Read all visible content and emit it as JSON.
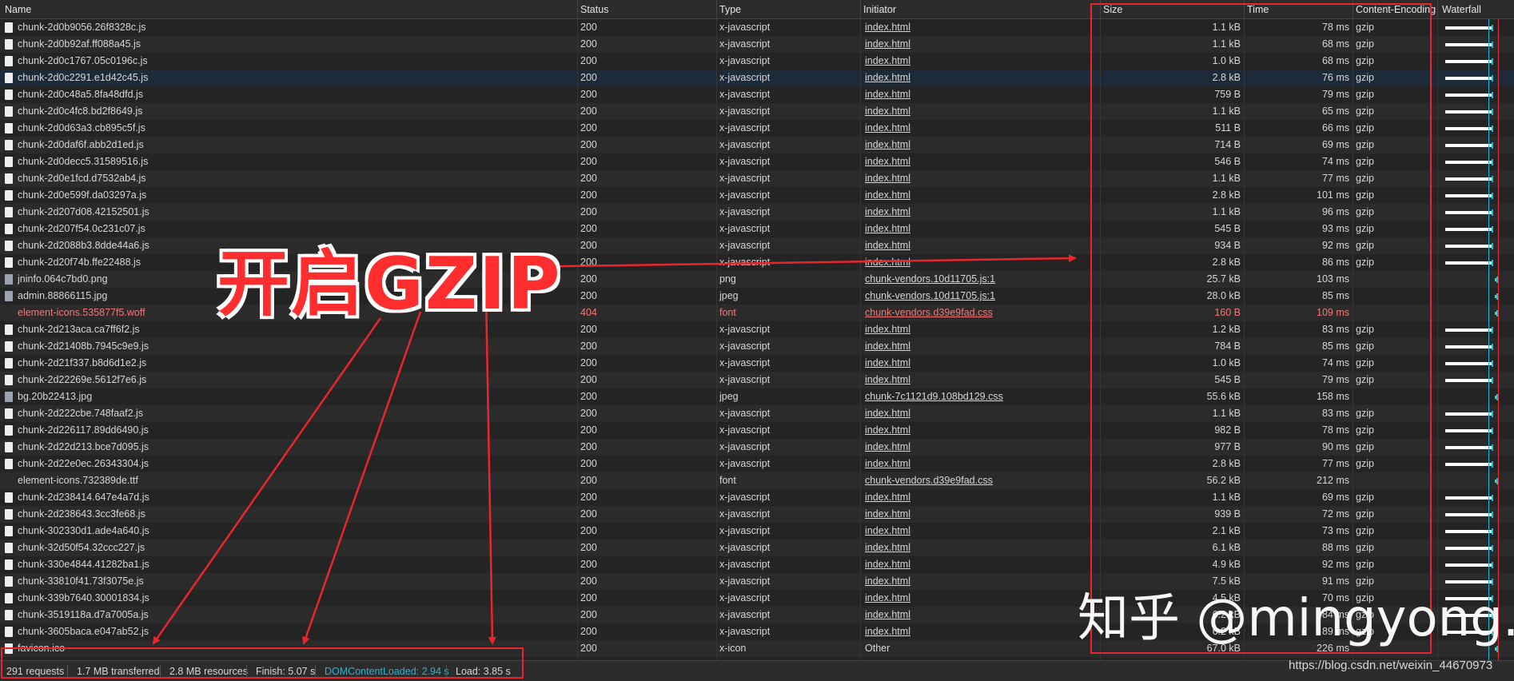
{
  "columns": {
    "name": "Name",
    "status": "Status",
    "type": "Type",
    "initiator": "Initiator",
    "size": "Size",
    "time": "Time",
    "encoding": "Content-Encoding",
    "waterfall": "Waterfall"
  },
  "rows": [
    {
      "name": "chunk-2d0b9056.26f8328c.js",
      "status": "200",
      "type": "x-javascript",
      "initiator": "index.html",
      "size": "1.1 kB",
      "time": "78 ms",
      "encoding": "gzip",
      "icon": "file-icon"
    },
    {
      "name": "chunk-2d0b92af.ff088a45.js",
      "status": "200",
      "type": "x-javascript",
      "initiator": "index.html",
      "size": "1.1 kB",
      "time": "68 ms",
      "encoding": "gzip",
      "icon": "file-icon"
    },
    {
      "name": "chunk-2d0c1767.05c0196c.js",
      "status": "200",
      "type": "x-javascript",
      "initiator": "index.html",
      "size": "1.0 kB",
      "time": "68 ms",
      "encoding": "gzip",
      "icon": "file-icon"
    },
    {
      "name": "chunk-2d0c2291.e1d42c45.js",
      "status": "200",
      "type": "x-javascript",
      "initiator": "index.html",
      "size": "2.8 kB",
      "time": "76 ms",
      "encoding": "gzip",
      "icon": "file-icon"
    },
    {
      "name": "chunk-2d0c48a5.8fa48dfd.js",
      "status": "200",
      "type": "x-javascript",
      "initiator": "index.html",
      "size": "759 B",
      "time": "79 ms",
      "encoding": "gzip",
      "icon": "file-icon"
    },
    {
      "name": "chunk-2d0c4fc8.bd2f8649.js",
      "status": "200",
      "type": "x-javascript",
      "initiator": "index.html",
      "size": "1.1 kB",
      "time": "65 ms",
      "encoding": "gzip",
      "icon": "file-icon"
    },
    {
      "name": "chunk-2d0d63a3.cb895c5f.js",
      "status": "200",
      "type": "x-javascript",
      "initiator": "index.html",
      "size": "511 B",
      "time": "66 ms",
      "encoding": "gzip",
      "icon": "file-icon"
    },
    {
      "name": "chunk-2d0daf6f.abb2d1ed.js",
      "status": "200",
      "type": "x-javascript",
      "initiator": "index.html",
      "size": "714 B",
      "time": "69 ms",
      "encoding": "gzip",
      "icon": "file-icon"
    },
    {
      "name": "chunk-2d0decc5.31589516.js",
      "status": "200",
      "type": "x-javascript",
      "initiator": "index.html",
      "size": "546 B",
      "time": "74 ms",
      "encoding": "gzip",
      "icon": "file-icon"
    },
    {
      "name": "chunk-2d0e1fcd.d7532ab4.js",
      "status": "200",
      "type": "x-javascript",
      "initiator": "index.html",
      "size": "1.1 kB",
      "time": "77 ms",
      "encoding": "gzip",
      "icon": "file-icon"
    },
    {
      "name": "chunk-2d0e599f.da03297a.js",
      "status": "200",
      "type": "x-javascript",
      "initiator": "index.html",
      "size": "2.8 kB",
      "time": "101 ms",
      "encoding": "gzip",
      "icon": "file-icon"
    },
    {
      "name": "chunk-2d207d08.42152501.js",
      "status": "200",
      "type": "x-javascript",
      "initiator": "index.html",
      "size": "1.1 kB",
      "time": "96 ms",
      "encoding": "gzip",
      "icon": "file-icon"
    },
    {
      "name": "chunk-2d207f54.0c231c07.js",
      "status": "200",
      "type": "x-javascript",
      "initiator": "index.html",
      "size": "545 B",
      "time": "93 ms",
      "encoding": "gzip",
      "icon": "file-icon"
    },
    {
      "name": "chunk-2d2088b3.8dde44a6.js",
      "status": "200",
      "type": "x-javascript",
      "initiator": "index.html",
      "size": "934 B",
      "time": "92 ms",
      "encoding": "gzip",
      "icon": "file-icon"
    },
    {
      "name": "chunk-2d20f74b.ffe22488.js",
      "status": "200",
      "type": "x-javascript",
      "initiator": "index.html",
      "size": "2.8 kB",
      "time": "86 ms",
      "encoding": "gzip",
      "icon": "file-icon"
    },
    {
      "name": "jninfo.064c7bd0.png",
      "status": "200",
      "type": "png",
      "initiator": "chunk-vendors.10d11705.js:1",
      "size": "25.7 kB",
      "time": "103 ms",
      "encoding": "",
      "icon": "image-icon"
    },
    {
      "name": "admin.88866115.jpg",
      "status": "200",
      "type": "jpeg",
      "initiator": "chunk-vendors.10d11705.js:1",
      "size": "28.0 kB",
      "time": "85 ms",
      "encoding": "",
      "icon": "image-icon"
    },
    {
      "name": "element-icons.535877f5.woff",
      "status": "404",
      "type": "font",
      "initiator": "chunk-vendors.d39e9fad.css",
      "size": "160 B",
      "time": "109 ms",
      "encoding": "",
      "icon": "none",
      "error": true
    },
    {
      "name": "chunk-2d213aca.ca7ff6f2.js",
      "status": "200",
      "type": "x-javascript",
      "initiator": "index.html",
      "size": "1.2 kB",
      "time": "83 ms",
      "encoding": "gzip",
      "icon": "file-icon"
    },
    {
      "name": "chunk-2d21408b.7945c9e9.js",
      "status": "200",
      "type": "x-javascript",
      "initiator": "index.html",
      "size": "784 B",
      "time": "85 ms",
      "encoding": "gzip",
      "icon": "file-icon"
    },
    {
      "name": "chunk-2d21f337.b8d6d1e2.js",
      "status": "200",
      "type": "x-javascript",
      "initiator": "index.html",
      "size": "1.0 kB",
      "time": "74 ms",
      "encoding": "gzip",
      "icon": "file-icon"
    },
    {
      "name": "chunk-2d22269e.5612f7e6.js",
      "status": "200",
      "type": "x-javascript",
      "initiator": "index.html",
      "size": "545 B",
      "time": "79 ms",
      "encoding": "gzip",
      "icon": "file-icon"
    },
    {
      "name": "bg.20b22413.jpg",
      "status": "200",
      "type": "jpeg",
      "initiator": "chunk-7c1121d9.108bd129.css",
      "size": "55.6 kB",
      "time": "158 ms",
      "encoding": "",
      "icon": "image-icon"
    },
    {
      "name": "chunk-2d222cbe.748faaf2.js",
      "status": "200",
      "type": "x-javascript",
      "initiator": "index.html",
      "size": "1.1 kB",
      "time": "83 ms",
      "encoding": "gzip",
      "icon": "file-icon"
    },
    {
      "name": "chunk-2d226117.89dd6490.js",
      "status": "200",
      "type": "x-javascript",
      "initiator": "index.html",
      "size": "982 B",
      "time": "78 ms",
      "encoding": "gzip",
      "icon": "file-icon"
    },
    {
      "name": "chunk-2d22d213.bce7d095.js",
      "status": "200",
      "type": "x-javascript",
      "initiator": "index.html",
      "size": "977 B",
      "time": "90 ms",
      "encoding": "gzip",
      "icon": "file-icon"
    },
    {
      "name": "chunk-2d22e0ec.26343304.js",
      "status": "200",
      "type": "x-javascript",
      "initiator": "index.html",
      "size": "2.8 kB",
      "time": "77 ms",
      "encoding": "gzip",
      "icon": "file-icon"
    },
    {
      "name": "element-icons.732389de.ttf",
      "status": "200",
      "type": "font",
      "initiator": "chunk-vendors.d39e9fad.css",
      "size": "56.2 kB",
      "time": "212 ms",
      "encoding": "",
      "icon": "none"
    },
    {
      "name": "chunk-2d238414.647e4a7d.js",
      "status": "200",
      "type": "x-javascript",
      "initiator": "index.html",
      "size": "1.1 kB",
      "time": "69 ms",
      "encoding": "gzip",
      "icon": "file-icon"
    },
    {
      "name": "chunk-2d238643.3cc3fe68.js",
      "status": "200",
      "type": "x-javascript",
      "initiator": "index.html",
      "size": "939 B",
      "time": "72 ms",
      "encoding": "gzip",
      "icon": "file-icon"
    },
    {
      "name": "chunk-302330d1.ade4a640.js",
      "status": "200",
      "type": "x-javascript",
      "initiator": "index.html",
      "size": "2.1 kB",
      "time": "73 ms",
      "encoding": "gzip",
      "icon": "file-icon"
    },
    {
      "name": "chunk-32d50f54.32ccc227.js",
      "status": "200",
      "type": "x-javascript",
      "initiator": "index.html",
      "size": "6.1 kB",
      "time": "88 ms",
      "encoding": "gzip",
      "icon": "file-icon"
    },
    {
      "name": "chunk-330e4844.41282ba1.js",
      "status": "200",
      "type": "x-javascript",
      "initiator": "index.html",
      "size": "4.9 kB",
      "time": "92 ms",
      "encoding": "gzip",
      "icon": "file-icon"
    },
    {
      "name": "chunk-33810f41.73f3075e.js",
      "status": "200",
      "type": "x-javascript",
      "initiator": "index.html",
      "size": "7.5 kB",
      "time": "91 ms",
      "encoding": "gzip",
      "icon": "file-icon"
    },
    {
      "name": "chunk-339b7640.30001834.js",
      "status": "200",
      "type": "x-javascript",
      "initiator": "index.html",
      "size": "4.5 kB",
      "time": "70 ms",
      "encoding": "gzip",
      "icon": "file-icon"
    },
    {
      "name": "chunk-3519118a.d7a7005a.js",
      "status": "200",
      "type": "x-javascript",
      "initiator": "index.html",
      "size": "6.2 kB",
      "time": "84 ms",
      "encoding": "gzip",
      "icon": "file-icon"
    },
    {
      "name": "chunk-3605baca.e047ab52.js",
      "status": "200",
      "type": "x-javascript",
      "initiator": "index.html",
      "size": "6.2 kB",
      "time": "89 ms",
      "encoding": "gzip",
      "icon": "file-icon"
    },
    {
      "name": "favicon.ico",
      "status": "200",
      "type": "x-icon",
      "initiator": "Other",
      "size": "67.0 kB",
      "time": "226 ms",
      "encoding": "",
      "icon": "file-icon"
    }
  ],
  "status_bar": {
    "requests": "291 requests",
    "transferred": "1.7 MB transferred",
    "resources": "2.8 MB resources",
    "finish": "Finish: 5.07 s",
    "dcl": "DOMContentLoaded: 2.94 s",
    "load": "Load: 3.85 s"
  },
  "annotation": {
    "title": "开启GZIP",
    "watermark": "知乎 @mingyong.g",
    "url": "https://blog.csdn.net/weixin_44670973"
  },
  "colors": {
    "annotation_red": "#e8262d",
    "dcl_blue": "#1fb8d6",
    "error_red": "#f07a7a"
  }
}
